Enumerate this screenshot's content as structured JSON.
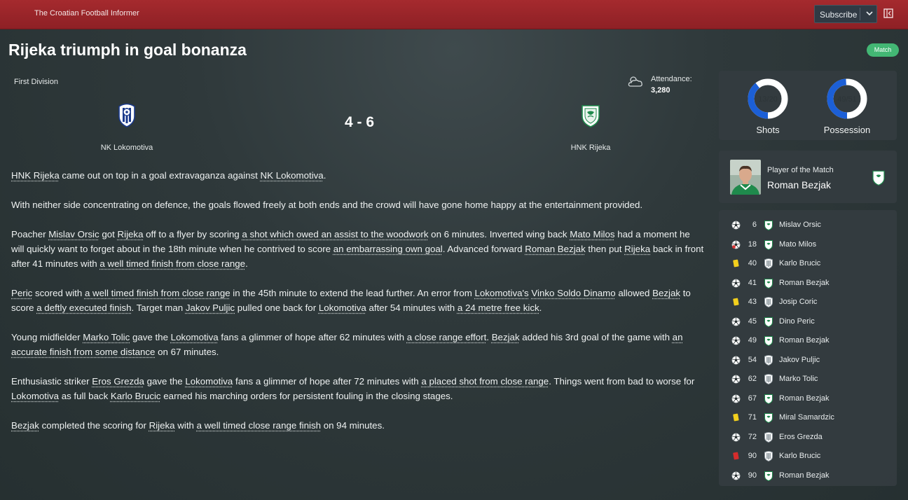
{
  "header": {
    "publication": "The Croatian Football Informer",
    "subscribe_label": "Subscribe"
  },
  "article_title": "Rijeka triumph in goal bonanza",
  "badge": "Match",
  "match": {
    "competition": "First Division",
    "attendance_label": "Attendance:",
    "attendance_value": "3,280",
    "home_team": "NK Lokomotiva",
    "away_team": "HNK Rijeka",
    "score": "4 - 6"
  },
  "stats": {
    "shots": {
      "label": "Shots",
      "value": "13/20",
      "home": 13,
      "away": 20
    },
    "possession": {
      "label": "Possession",
      "value": "49/51",
      "home": 49,
      "away": 51
    },
    "colors": {
      "home": "#1c5fd6",
      "away": "#ffffff"
    }
  },
  "potm": {
    "label": "Player of the Match",
    "name": "Roman Bezjak"
  },
  "article": [
    [
      {
        "t": "HNK Rijeka",
        "u": true
      },
      {
        "t": " came out on top in a goal extravaganza against "
      },
      {
        "t": "NK Lokomotiva",
        "u": true
      },
      {
        "t": "."
      }
    ],
    [
      {
        "t": "With neither side concentrating on defence, the goals flowed freely at both ends and the crowd will have gone home happy at the entertainment provided."
      }
    ],
    [
      {
        "t": "Poacher "
      },
      {
        "t": "Mislav Orsic",
        "u": true
      },
      {
        "t": " got "
      },
      {
        "t": "Rijeka",
        "u": true
      },
      {
        "t": " off to a flyer by scoring "
      },
      {
        "t": "a shot which owed an assist to the woodwork",
        "u": true
      },
      {
        "t": " on 6 minutes. Inverted wing back "
      },
      {
        "t": "Mato Milos",
        "u": true
      },
      {
        "t": " had a moment he will quickly want to forget about in the 18th minute when he contrived to score "
      },
      {
        "t": "an embarrassing own goal",
        "u": true
      },
      {
        "t": ". Advanced forward "
      },
      {
        "t": "Roman Bezjak",
        "u": true
      },
      {
        "t": " then put "
      },
      {
        "t": "Rijeka",
        "u": true
      },
      {
        "t": " back in front after 41 minutes with "
      },
      {
        "t": "a well timed finish from close range",
        "u": true
      },
      {
        "t": "."
      }
    ],
    [
      {
        "t": "Peric",
        "u": true
      },
      {
        "t": " scored with "
      },
      {
        "t": "a well timed finish from close range",
        "u": true
      },
      {
        "t": " in the 45th minute to extend the lead further. An error from "
      },
      {
        "t": "Lokomotiva's",
        "u": true
      },
      {
        "t": " "
      },
      {
        "t": "Vinko Soldo Dinamo",
        "u": true
      },
      {
        "t": " allowed "
      },
      {
        "t": "Bezjak",
        "u": true
      },
      {
        "t": " to score "
      },
      {
        "t": "a deftly executed finish",
        "u": true
      },
      {
        "t": ". Target man "
      },
      {
        "t": "Jakov Puljic",
        "u": true
      },
      {
        "t": " pulled one back for "
      },
      {
        "t": "Lokomotiva",
        "u": true
      },
      {
        "t": " after 54 minutes with "
      },
      {
        "t": "a 24 metre free kick",
        "u": true
      },
      {
        "t": "."
      }
    ],
    [
      {
        "t": "Young midfielder "
      },
      {
        "t": "Marko Tolic",
        "u": true
      },
      {
        "t": " gave the "
      },
      {
        "t": "Lokomotiva",
        "u": true
      },
      {
        "t": " fans a glimmer of hope after 62 minutes with "
      },
      {
        "t": "a close range effort",
        "u": true
      },
      {
        "t": ". "
      },
      {
        "t": "Bezjak",
        "u": true
      },
      {
        "t": " added his 3rd goal of the game with "
      },
      {
        "t": "an accurate finish from some distance",
        "u": true
      },
      {
        "t": " on 67 minutes."
      }
    ],
    [
      {
        "t": "Enthusiastic striker "
      },
      {
        "t": "Eros Grezda",
        "u": true
      },
      {
        "t": " gave the "
      },
      {
        "t": "Lokomotiva",
        "u": true
      },
      {
        "t": " fans a glimmer of hope after 72 minutes with "
      },
      {
        "t": "a placed shot from close range",
        "u": true
      },
      {
        "t": ". Things went from bad to worse for "
      },
      {
        "t": "Lokomotiva",
        "u": true
      },
      {
        "t": " as full back "
      },
      {
        "t": "Karlo Brucic",
        "u": true
      },
      {
        "t": " earned his marching orders for persistent fouling in the closing stages."
      }
    ],
    [
      {
        "t": "Bezjak",
        "u": true
      },
      {
        "t": " completed the scoring for "
      },
      {
        "t": "Rijeka",
        "u": true
      },
      {
        "t": " with "
      },
      {
        "t": "a well timed close range finish",
        "u": true
      },
      {
        "t": " on 94 minutes."
      }
    ]
  ],
  "events": [
    {
      "type": "goal",
      "minute": "6",
      "team": "away",
      "player": "Mislav Orsic"
    },
    {
      "type": "own-goal",
      "minute": "18",
      "team": "away",
      "player": "Mato Milos"
    },
    {
      "type": "yellow",
      "minute": "40",
      "team": "home",
      "player": "Karlo Brucic"
    },
    {
      "type": "goal",
      "minute": "41",
      "team": "away",
      "player": "Roman Bezjak"
    },
    {
      "type": "yellow",
      "minute": "43",
      "team": "home",
      "player": "Josip Coric"
    },
    {
      "type": "goal",
      "minute": "45",
      "team": "away",
      "player": "Dino Peric"
    },
    {
      "type": "goal",
      "minute": "49",
      "team": "away",
      "player": "Roman Bezjak"
    },
    {
      "type": "goal",
      "minute": "54",
      "team": "home",
      "player": "Jakov Puljic"
    },
    {
      "type": "goal",
      "minute": "62",
      "team": "home",
      "player": "Marko Tolic"
    },
    {
      "type": "goal",
      "minute": "67",
      "team": "away",
      "player": "Roman Bezjak"
    },
    {
      "type": "yellow",
      "minute": "71",
      "team": "away",
      "player": "Miral Samardzic"
    },
    {
      "type": "goal",
      "minute": "72",
      "team": "home",
      "player": "Eros Grezda"
    },
    {
      "type": "red",
      "minute": "90",
      "team": "home",
      "player": "Karlo Brucic"
    },
    {
      "type": "goal",
      "minute": "90",
      "team": "away",
      "player": "Roman Bezjak"
    }
  ],
  "icons": {
    "goal": "football-icon",
    "own-goal": "own-goal-icon",
    "yellow": "yellow-card-icon",
    "red": "red-card-icon",
    "home_crest": "nk-lokomotiva-crest-icon",
    "away_crest": "hnk-rijeka-crest-icon"
  }
}
